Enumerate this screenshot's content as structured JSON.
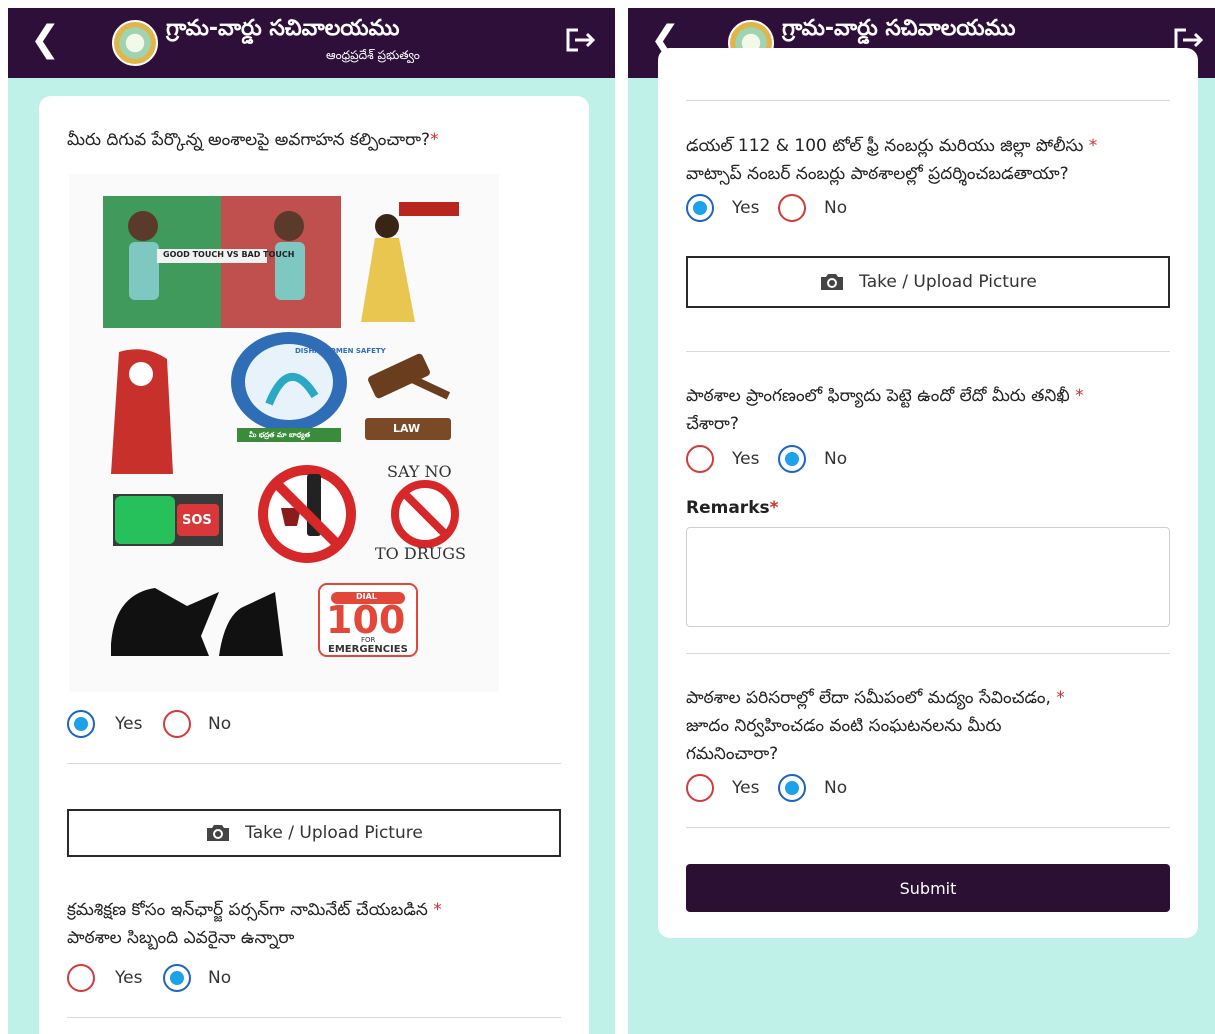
{
  "app": {
    "title": "గ్రామ-వార్డు సచివాలయము",
    "subtitle": "ఆంధ్రప్రదేశ్ ప్రభుత్వం"
  },
  "labels": {
    "yes": "Yes",
    "no": "No",
    "upload": "Take / Upload Picture",
    "remarks": "Remarks",
    "submit": "Submit",
    "required": "*"
  },
  "left": {
    "q1": "మీరు దిగువ పేర్కొన్న అంశాలపై అవగాహన కల్పించారా?",
    "q1_answer": "Yes",
    "q2_line1": "క్రమశిక్షణ కోసం ఇన్‌ఛార్జ్ పర్సన్‌గా నామినేట్ చేయబడిన",
    "q2_line2": "పాఠశాల సిబ్బంది ఎవరైనా ఉన్నారా",
    "q2_answer": "No"
  },
  "infographic": {
    "touch_caption": "GOOD TOUCH VS BAD TOUCH",
    "disha_text": "DISHA WOMEN SAFETY",
    "disha_tagline": "మీ భద్రత మా బాధ్యత",
    "law": "LAW",
    "sos": "SOS",
    "say_no": "SAY NO",
    "to_drugs": "TO DRUGS",
    "dial": "DIAL",
    "dial_number": "100",
    "for": "FOR",
    "emergencies": "EMERGENCIES"
  },
  "right": {
    "q3_line1": "డయల్ 112 & 100 టోల్ ఫ్రీ నంబర్లు మరియు జిల్లా పోలీసు",
    "q3_line2": "వాట్సాప్ నంబర్ నంబర్లు పాఠశాలల్లో ప్రదర్శించబడతాయా?",
    "q3_answer": "Yes",
    "q4_line1": "పాఠశాల ప్రాంగణంలో ఫిర్యాదు పెట్టె ఉందో లేదో మీరు తనిఖీ",
    "q4_line2": "చేశారా?",
    "q4_answer": "No",
    "remarks_value": "",
    "q5_line1": "పాఠశాల పరిసరాల్లో లేదా సమీపంలో మద్యం సేవించడం,",
    "q5_line2": "జూదం నిర్వహించడం వంటి సంఘటనలను మీరు",
    "q5_line3": "గమనించారా?",
    "q5_answer": "No"
  },
  "colors": {
    "app_bar": "#2d0f3a",
    "background": "#bff1e8",
    "radio_selected": "#1da1e8",
    "required": "#d32f2f",
    "submit": "#2b1034"
  },
  "icons": [
    "back-icon",
    "emblem-logo",
    "logout-icon",
    "camera-icon"
  ]
}
